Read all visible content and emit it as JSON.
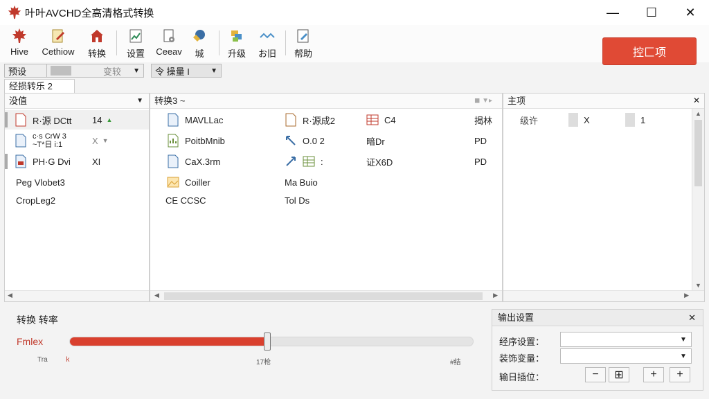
{
  "window": {
    "title": "叶叶AVCHD全高清格式转换",
    "minimize": "—",
    "maximize": "☐",
    "close": "✕",
    "brand_color": "#c0392b"
  },
  "toolbar": {
    "items": [
      {
        "label": "Hive",
        "icon": "maple-leaf-icon"
      },
      {
        "label": "Cethiow",
        "icon": "document-pencil-icon"
      },
      {
        "label": "转换",
        "icon": "home-icon"
      },
      {
        "label": "设置",
        "icon": "chart-document-icon"
      },
      {
        "label": "Ceeav",
        "icon": "document-gear-icon"
      },
      {
        "label": "城",
        "icon": "globe-tag-icon"
      },
      {
        "label": "升级",
        "icon": "stack-icon"
      },
      {
        "label": "お旧",
        "icon": "wave-icon"
      },
      {
        "label": "帮助",
        "icon": "edit-icon"
      }
    ],
    "cta_label": "控匚项",
    "cta_color": "#e04a35"
  },
  "filterbar": {
    "preset_label": "预设",
    "dropdown_placeholder": "变较",
    "volume_label": "令 操量 I"
  },
  "subtab": {
    "label": "经损转乐 2"
  },
  "source_panel": {
    "header": "没值",
    "rows": [
      {
        "name": "R·源 DCtt",
        "value": "14",
        "trend": "▲"
      },
      {
        "name_line1": "c·s CrW 3",
        "name_line2": "~T*日 i:1",
        "value": "X",
        "trend": "▼"
      },
      {
        "name": "PH·G Dvi",
        "value": "XI"
      },
      {
        "name": "Peg Vlobet3"
      },
      {
        "name": "CropLeg2"
      }
    ]
  },
  "convert_panel": {
    "header": "转换3 ~",
    "rows": [
      {
        "c1": "MAVLLac",
        "c2": "R·源成2",
        "c3": "C4",
        "c4": "揭林"
      },
      {
        "c1": "PoitbMnib",
        "c2": "O.0 2",
        "c3": "暗Dr",
        "c4": "PD"
      },
      {
        "c1": "CaX.3rm",
        "c2": ":",
        "c3": "证X6D",
        "c4": "PD"
      },
      {
        "c1": "Coiller",
        "c2": "Ma Buio"
      },
      {
        "c1": "CE CCSC",
        "c2": "Tol Ds"
      }
    ]
  },
  "props_panel": {
    "header": "主项",
    "row": {
      "label": "级许",
      "x": "X",
      "v": "1"
    }
  },
  "progress": {
    "title": "转换 转率",
    "label": "Fmlex",
    "percent": 0.49,
    "tick_left": "Tra",
    "tick_left_red": "k",
    "tick_mid": "17枪",
    "tick_right": "#结",
    "fill_color": "#d9402e"
  },
  "settings": {
    "title": "输出设置",
    "row1_label": "经序设置：",
    "row2_label": "装饰变量：",
    "row3_label": "输日插位：",
    "minus": "−",
    "center": "⊞",
    "plus1": "+",
    "plus2": "+"
  }
}
